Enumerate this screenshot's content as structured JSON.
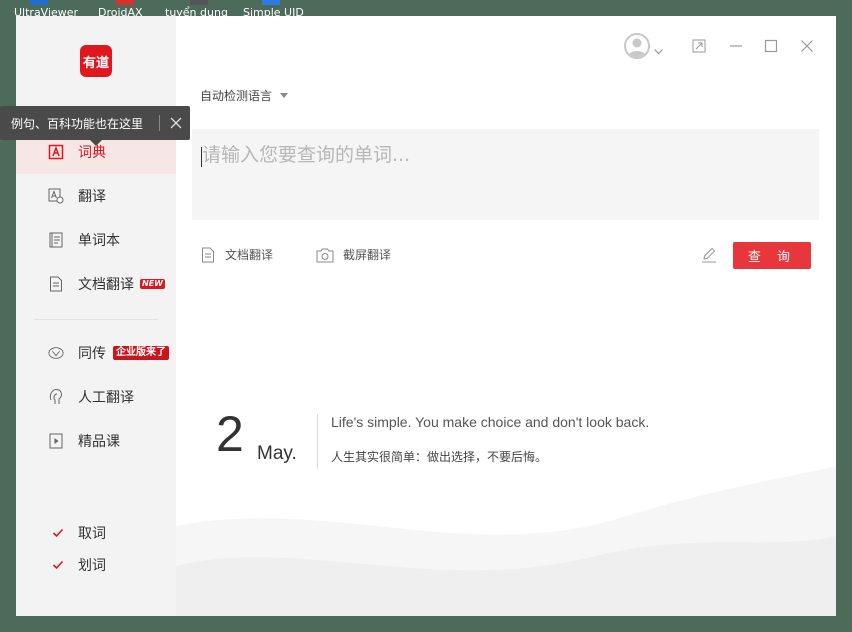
{
  "desktop": {
    "icons": [
      {
        "label": "UltraViewer",
        "color": "#1f6fd1"
      },
      {
        "label": "DroidAX",
        "color": "#d8302f"
      },
      {
        "label": "tuyển dụng",
        "color": "#555555"
      },
      {
        "label": "Simple UID",
        "color": "#2d7be0"
      }
    ]
  },
  "app": {
    "brand": {
      "logo_text": "有道",
      "color": "#e1171e"
    }
  },
  "tooltip": {
    "text": "例句、百科功能也在这里",
    "close_icon": "close-icon"
  },
  "sidebar": {
    "items": [
      {
        "label": "词典",
        "icon": "dictionary-icon",
        "active": true
      },
      {
        "label": "翻译",
        "icon": "translate-icon"
      },
      {
        "label": "单词本",
        "icon": "wordbook-icon"
      },
      {
        "label": "文档翻译",
        "icon": "document-icon",
        "badge": "NEW"
      },
      {
        "label": "同传",
        "icon": "interpretation-icon",
        "badge": "企业版来了"
      },
      {
        "label": "人工翻译",
        "icon": "human-translation-icon"
      },
      {
        "label": "精品课",
        "icon": "course-icon"
      }
    ],
    "checks": [
      {
        "label": "取词",
        "checked": true
      },
      {
        "label": "划词",
        "checked": true
      }
    ]
  },
  "main": {
    "language": "自动检测语言",
    "search_placeholder": "请输入您要查询的单词...",
    "tools": {
      "doc_translate": "文档翻译",
      "screenshot_translate": "截屏翻译"
    },
    "query_button": "查 询",
    "accent_color": "#e8373c"
  },
  "daily": {
    "day": "2",
    "month": "May.",
    "quote_en": "Life's simple. You make choice and don't look back.",
    "quote_zh": "人生其实很简单：做出选择，不要后悔。"
  }
}
